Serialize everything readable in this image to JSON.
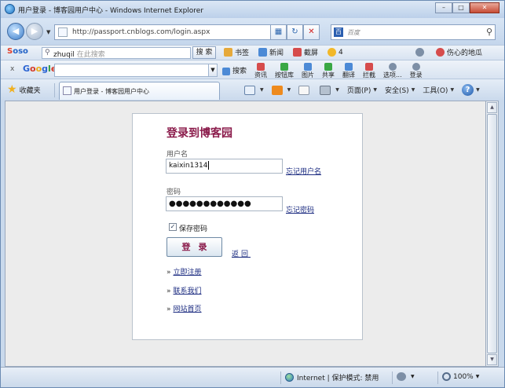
{
  "window": {
    "title": "用户登录 - 博客园用户中心 - Windows Internet Explorer",
    "minimize": "–",
    "maximize": "□",
    "close": "✕"
  },
  "address": {
    "url": "http://passport.cnblogs.com/login.aspx",
    "search_placeholder": "百度",
    "back_glyph": "◀",
    "forward_glyph": "▶",
    "refresh_glyph": "↻",
    "stop_glyph": "✕",
    "compat_glyph": "▦",
    "search_go_glyph": "⚲"
  },
  "soso_toolbar": {
    "logo_s": "S",
    "logo_rest": "oso",
    "query": "zhuqil",
    "query_hint": "在此搜索",
    "search_button": "搜 索",
    "items": [
      "书签",
      "新闻",
      "截屏",
      "4"
    ],
    "right_item": "伤心的地瓜"
  },
  "google_toolbar": {
    "close": "x",
    "logo": [
      "G",
      "o",
      "o",
      "g",
      "l",
      "e"
    ],
    "search_label": "搜索",
    "items": [
      "资讯",
      "按钮库",
      "图片",
      "共享",
      "翻译",
      "拦截",
      "选项...",
      "登录"
    ]
  },
  "tab_bar": {
    "favorites": "收藏夹",
    "tab_title": "用户登录 - 博客园用户中心",
    "commands": [
      "页面(P)",
      "安全(S)",
      "工具(O)"
    ]
  },
  "login": {
    "title": "登录到博客园",
    "username_label": "用户名",
    "username_value": "kaixin1314",
    "forgot_username": "忘记用户名",
    "password_label": "密码",
    "password_dots": "●●●●●●●●●●●●",
    "forgot_password": "忘记密码",
    "remember_label": "保存密码",
    "remember_checked": true,
    "login_button": "登录",
    "back_link": "返回",
    "links": [
      "立即注册",
      "联系我们",
      "网站首页"
    ]
  },
  "status_bar": {
    "zone": "Internet | 保护模式: 禁用",
    "zoom": "100%"
  },
  "colors": {
    "accent_title": "#8a1a4a",
    "link": "#1b2b80",
    "frame": "#c9d9ec"
  }
}
